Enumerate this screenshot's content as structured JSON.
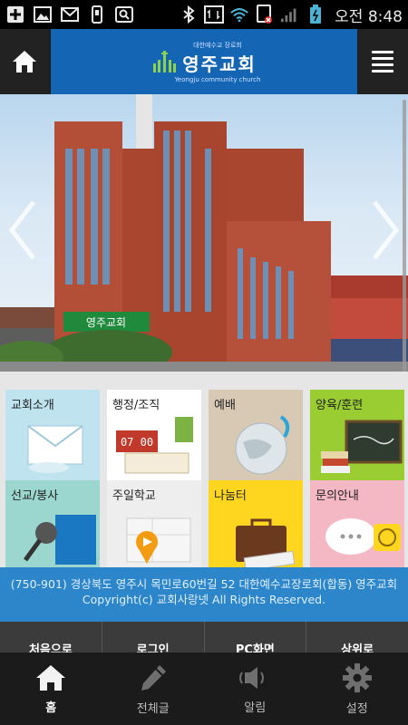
{
  "status_bar": {
    "time": "오전 8:48",
    "icons": [
      "add-icon",
      "image-icon",
      "mail-icon",
      "usb-icon",
      "search-icon",
      "bluetooth-icon",
      "data-icon",
      "wifi-icon",
      "sim-icon",
      "signal-icon",
      "battery-icon"
    ]
  },
  "header": {
    "logo_subtitle": "대한예수교 장로회",
    "logo_name": "영주교회",
    "logo_english": "Yeongju community church"
  },
  "banner": {
    "sign_text": "영주교회"
  },
  "menu": {
    "tiles": [
      {
        "label": "교회소개",
        "color": "#bfe3ef"
      },
      {
        "label": "행정/조직",
        "color": "#ffffff"
      },
      {
        "label": "예배",
        "color": "#d8c9b4"
      },
      {
        "label": "양육/훈련",
        "color": "#9acd32"
      },
      {
        "label": "선교/봉사",
        "color": "#9bd7ce"
      },
      {
        "label": "주일학교",
        "color": "#eeeeee"
      },
      {
        "label": "나눔터",
        "color": "#ffd61f"
      },
      {
        "label": "문의안내",
        "color": "#f4b8c4"
      }
    ]
  },
  "footer": {
    "address": "(750-901) 경상북도 영주시 목민로60번길 52 대한예수교장로회(합동) 영주교회",
    "copyright": "Copyright(c) 교회사랑넷 All Rights Reserved."
  },
  "links": [
    "처음으로",
    "로그인",
    "PC화면",
    "상위로"
  ],
  "tabs": [
    {
      "label": "홈",
      "icon": "home-icon"
    },
    {
      "label": "전체글",
      "icon": "pencil-icon"
    },
    {
      "label": "알림",
      "icon": "speaker-icon"
    },
    {
      "label": "설정",
      "icon": "gear-icon"
    }
  ],
  "colors": {
    "header_blue": "#1565b5",
    "footer_blue": "#2c86c9",
    "tabbar": "#1b1b1b"
  }
}
